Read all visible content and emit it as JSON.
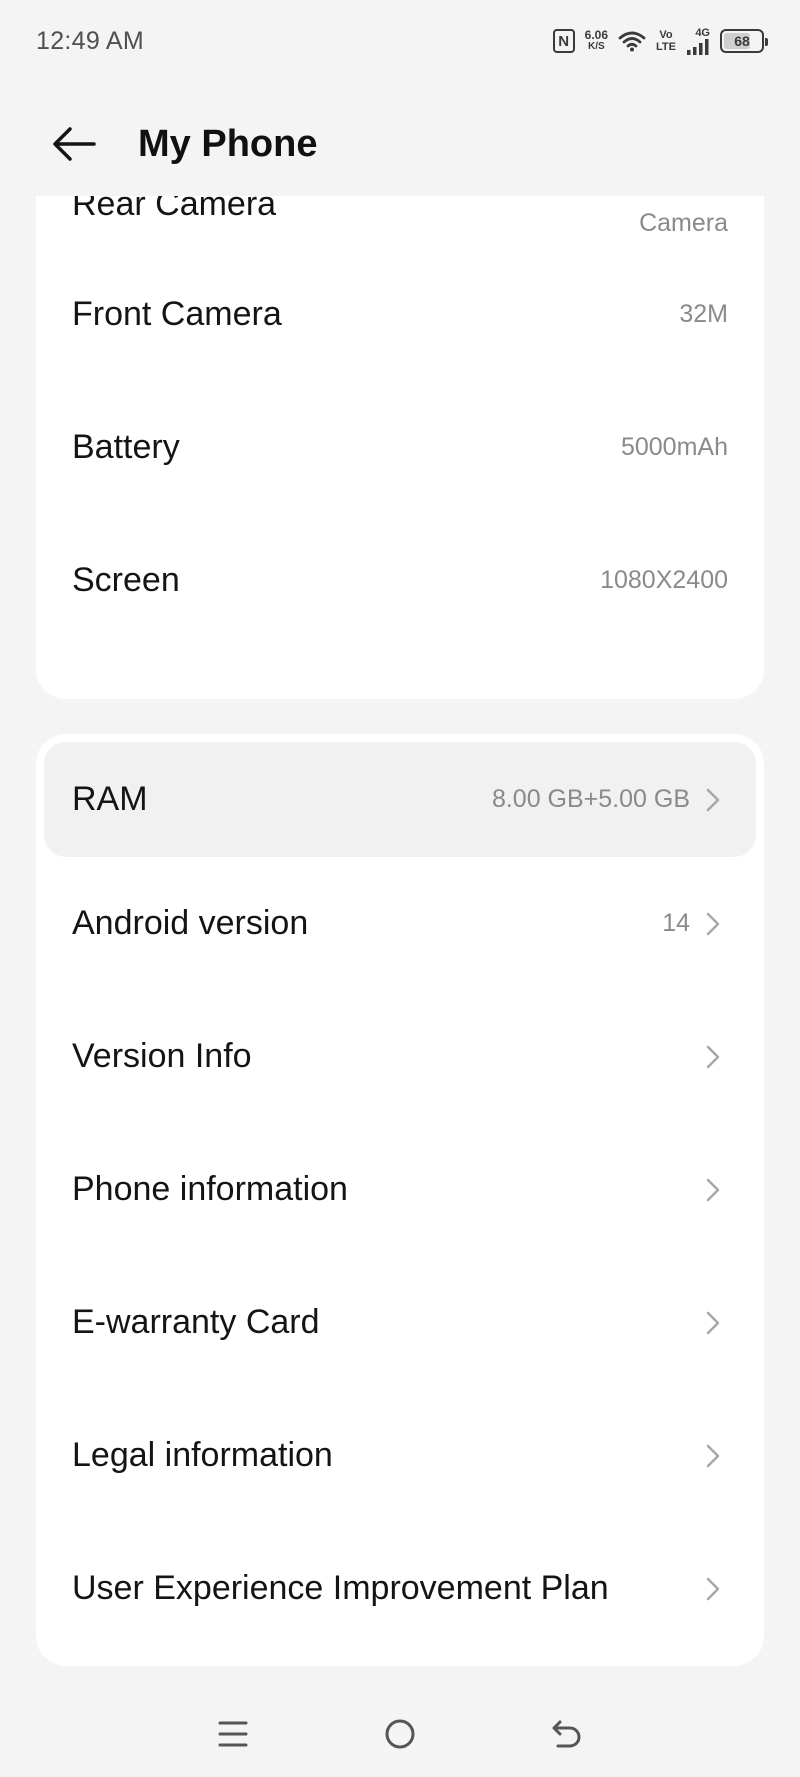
{
  "status_bar": {
    "time": "12:49 AM",
    "nfc": "N",
    "speed_value": "6.06",
    "speed_unit": "K/S",
    "volte_top": "Vo",
    "volte_bottom": "LTE",
    "network": "4G",
    "battery": "68"
  },
  "header": {
    "title": "My Phone"
  },
  "card_1": {
    "rows": [
      {
        "label": "Rear Camera",
        "value": "Camera"
      },
      {
        "label": "Front Camera",
        "value": "32M"
      },
      {
        "label": "Battery",
        "value": "5000mAh"
      },
      {
        "label": "Screen",
        "value": "1080X2400"
      }
    ]
  },
  "card_2": {
    "rows": [
      {
        "label": "RAM",
        "value": "8.00 GB+5.00 GB"
      },
      {
        "label": "Android version",
        "value": "14"
      },
      {
        "label": "Version Info",
        "value": ""
      },
      {
        "label": "Phone information",
        "value": ""
      },
      {
        "label": "E-warranty Card",
        "value": ""
      },
      {
        "label": "Legal information",
        "value": ""
      },
      {
        "label": "User Experience Improvement Plan",
        "value": ""
      }
    ]
  },
  "nav_bar": {
    "icons": [
      "menu-icon",
      "home-icon",
      "back-icon"
    ]
  },
  "colors": {
    "background": "#f4f4f4",
    "card": "#ffffff",
    "highlight": "#f1f1f1",
    "secondary_text": "#8a8a8a"
  }
}
